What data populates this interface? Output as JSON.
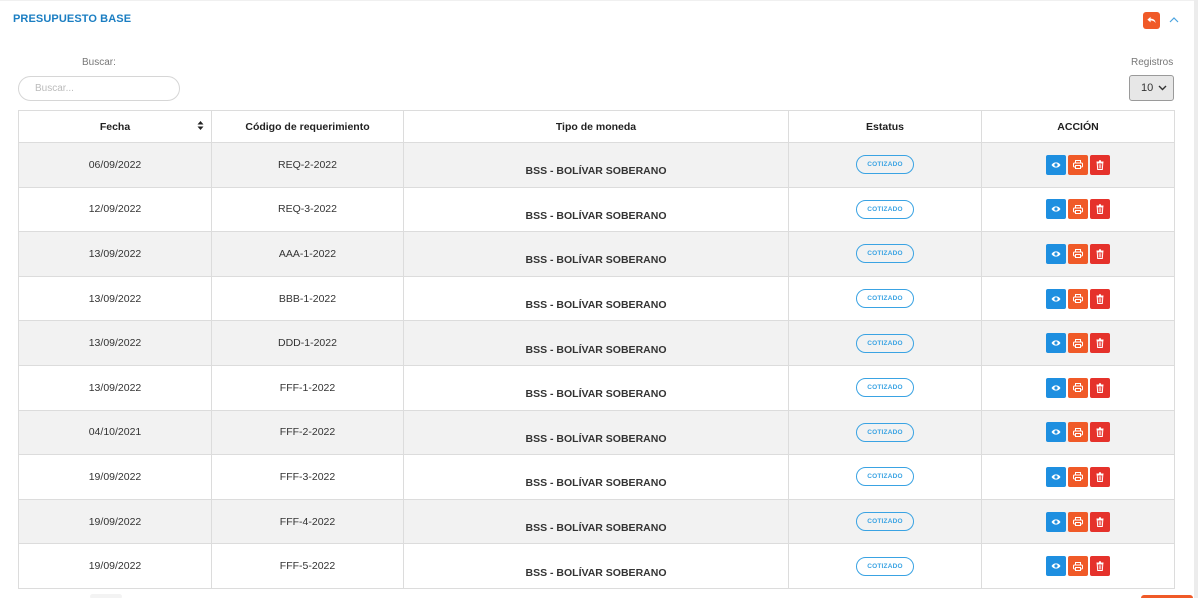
{
  "panel": {
    "title": "PRESUPUESTO BASE"
  },
  "search": {
    "label": "Buscar:",
    "placeholder": "Buscar...",
    "value": ""
  },
  "registros": {
    "label": "Registros",
    "value": "10"
  },
  "table": {
    "headers": [
      "Fecha",
      "Código de requerimiento",
      "Tipo de moneda",
      "Estatus",
      "ACCIÓN"
    ],
    "rows": [
      {
        "fecha": "06/09/2022",
        "codigo": "REQ-2-2022",
        "moneda": "BSS - BOLÍVAR SOBERANO",
        "estatus": "COTIZADO"
      },
      {
        "fecha": "12/09/2022",
        "codigo": "REQ-3-2022",
        "moneda": "BSS - BOLÍVAR SOBERANO",
        "estatus": "COTIZADO"
      },
      {
        "fecha": "13/09/2022",
        "codigo": "AAA-1-2022",
        "moneda": "BSS - BOLÍVAR SOBERANO",
        "estatus": "COTIZADO"
      },
      {
        "fecha": "13/09/2022",
        "codigo": "BBB-1-2022",
        "moneda": "BSS - BOLÍVAR SOBERANO",
        "estatus": "COTIZADO"
      },
      {
        "fecha": "13/09/2022",
        "codigo": "DDD-1-2022",
        "moneda": "BSS - BOLÍVAR SOBERANO",
        "estatus": "COTIZADO"
      },
      {
        "fecha": "13/09/2022",
        "codigo": "FFF-1-2022",
        "moneda": "BSS - BOLÍVAR SOBERANO",
        "estatus": "COTIZADO"
      },
      {
        "fecha": "04/10/2021",
        "codigo": "FFF-2-2022",
        "moneda": "BSS - BOLÍVAR SOBERANO",
        "estatus": "COTIZADO"
      },
      {
        "fecha": "19/09/2022",
        "codigo": "FFF-3-2022",
        "moneda": "BSS - BOLÍVAR SOBERANO",
        "estatus": "COTIZADO"
      },
      {
        "fecha": "19/09/2022",
        "codigo": "FFF-4-2022",
        "moneda": "BSS - BOLÍVAR SOBERANO",
        "estatus": "COTIZADO"
      },
      {
        "fecha": "19/09/2022",
        "codigo": "FFF-5-2022",
        "moneda": "BSS - BOLÍVAR SOBERANO",
        "estatus": "COTIZADO"
      }
    ]
  },
  "colors": {
    "title": "#1b7ec2",
    "accent_orange": "#f05a28",
    "view_blue": "#1e8fe0",
    "delete_red": "#e5322b",
    "badge_blue": "#3aa3e3"
  },
  "icons": {
    "back": "undo-arrow-icon",
    "collapse": "chevron-up-icon",
    "sort": "sort-icon",
    "view": "eye-icon",
    "print": "print-icon",
    "delete": "trash-icon"
  }
}
